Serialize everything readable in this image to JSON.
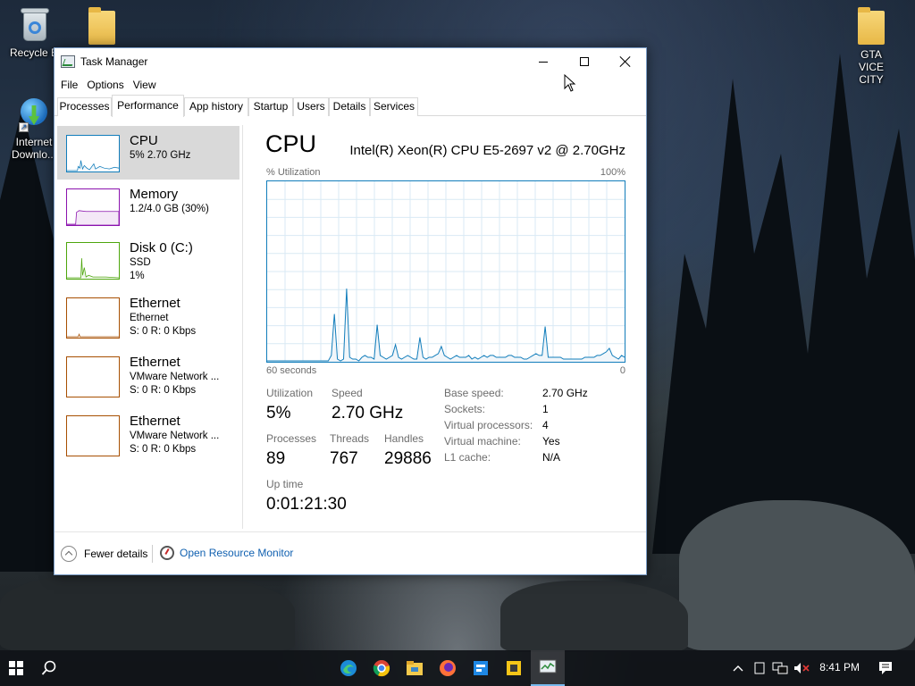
{
  "desktop": {
    "icons": [
      {
        "label": "Recycle B",
        "icon": "recycle-bin-icon"
      },
      {
        "label": "",
        "icon": "folder-icon"
      },
      {
        "label": "Internet Downlo...",
        "icon": "internet-download-manager-icon"
      },
      {
        "label": "GTA VICE CITY",
        "icon": "folder-icon"
      }
    ]
  },
  "window": {
    "title": "Task Manager",
    "menu": [
      "File",
      "Options",
      "View"
    ],
    "tabs": [
      "Processes",
      "Performance",
      "App history",
      "Startup",
      "Users",
      "Details",
      "Services"
    ],
    "active_tab": "Performance"
  },
  "resources": [
    {
      "name": "CPU",
      "sub1": "5% 2.70 GHz",
      "sub2": "",
      "color": "#117dbb"
    },
    {
      "name": "Memory",
      "sub1": "1.2/4.0 GB (30%)",
      "sub2": "",
      "color": "#8b12ae"
    },
    {
      "name": "Disk 0 (C:)",
      "sub1": "SSD",
      "sub2": "1%",
      "color": "#4da60c"
    },
    {
      "name": "Ethernet",
      "sub1": "Ethernet",
      "sub2": "S: 0 R: 0 Kbps",
      "color": "#a74f01"
    },
    {
      "name": "Ethernet",
      "sub1": "VMware Network ...",
      "sub2": "S: 0 R: 0 Kbps",
      "color": "#a74f01"
    },
    {
      "name": "Ethernet",
      "sub1": "VMware Network ...",
      "sub2": "S: 0 R: 0 Kbps",
      "color": "#a74f01"
    }
  ],
  "cpu": {
    "title": "CPU",
    "model": "Intel(R) Xeon(R) CPU E5-2697 v2 @ 2.70GHz",
    "y_label": "% Utilization",
    "y_max": "100%",
    "x_left": "60 seconds",
    "x_right": "0",
    "stats": {
      "utilization_label": "Utilization",
      "utilization": "5%",
      "speed_label": "Speed",
      "speed": "2.70 GHz",
      "processes_label": "Processes",
      "processes": "89",
      "threads_label": "Threads",
      "threads": "767",
      "handles_label": "Handles",
      "handles": "29886",
      "uptime_label": "Up time",
      "uptime": "0:01:21:30"
    },
    "details": [
      {
        "key": "Base speed:",
        "value": "2.70 GHz"
      },
      {
        "key": "Sockets:",
        "value": "1"
      },
      {
        "key": "Virtual processors:",
        "value": "4"
      },
      {
        "key": "Virtual machine:",
        "value": "Yes"
      },
      {
        "key": "L1 cache:",
        "value": "N/A"
      }
    ],
    "history_percent": [
      0,
      0,
      0,
      0,
      0,
      0,
      0,
      0,
      0,
      0,
      0,
      0,
      0,
      0,
      0,
      0,
      0,
      0,
      0,
      0,
      0,
      3,
      26,
      1,
      0,
      1,
      40,
      2,
      1,
      1,
      0,
      2,
      3,
      2,
      2,
      1,
      20,
      3,
      2,
      1,
      2,
      3,
      9,
      2,
      1,
      2,
      3,
      2,
      1,
      1,
      13,
      2,
      1,
      2,
      2,
      3,
      4,
      8,
      3,
      2,
      1,
      2,
      3,
      2,
      2,
      2,
      3,
      1,
      2,
      1,
      2,
      3,
      2,
      3,
      3,
      2,
      2,
      2,
      2,
      3,
      3,
      2,
      2,
      2,
      1,
      1,
      2,
      3,
      4,
      3,
      3,
      19,
      2,
      2,
      2,
      2,
      2,
      1,
      1,
      1,
      1,
      1,
      1,
      1,
      2,
      2,
      2,
      2,
      3,
      3,
      4,
      5,
      7,
      3,
      2,
      1,
      3,
      2
    ]
  },
  "footer": {
    "fewer": "Fewer details",
    "resmon": "Open Resource Monitor"
  },
  "taskbar": {
    "clock": "8:41 PM",
    "apps": [
      "edge-icon",
      "chrome-icon",
      "file-explorer-icon",
      "firefox-icon",
      "app-icon",
      "app-icon",
      "task-manager-icon"
    ]
  }
}
